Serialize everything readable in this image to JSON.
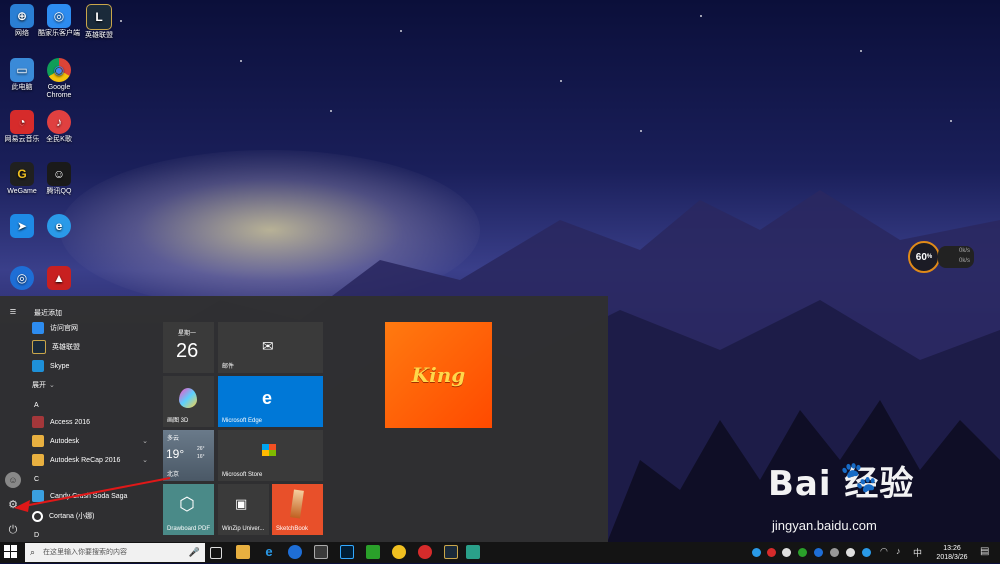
{
  "desktop": {
    "icons": [
      {
        "label": "网络",
        "color": "#2a7fd4",
        "glyph": "⊕"
      },
      {
        "label": "酷家乐客户端",
        "color": "#2d8cf0",
        "glyph": "◎"
      },
      {
        "label": "英雄联盟",
        "color": "#1a2a3a",
        "glyph": "L"
      },
      {
        "label": "此电脑",
        "color": "#3a8ad8",
        "glyph": "▭"
      },
      {
        "label": "Google Chrome",
        "color": "#e0e0e0",
        "glyph": "◉"
      },
      {
        "label": "网易云音乐",
        "color": "#d62b2b",
        "glyph": "◔"
      },
      {
        "label": "全民K歌",
        "color": "#e04040",
        "glyph": "♪"
      },
      {
        "label": "WeGame",
        "color": "#202020",
        "glyph": "G"
      },
      {
        "label": "腾讯QQ",
        "color": "#1a1a1a",
        "glyph": "☺"
      },
      {
        "label": "",
        "color": "#1e8ae6",
        "glyph": "➤"
      },
      {
        "label": "",
        "color": "#2a9ae8",
        "glyph": "e"
      },
      {
        "label": "",
        "color": "#1e6ed6",
        "glyph": "◎"
      },
      {
        "label": "",
        "color": "#c82020",
        "glyph": "▲"
      }
    ]
  },
  "speed_widget": {
    "value": "60",
    "unit": "%",
    "up": "0k/s",
    "down": "0k/s"
  },
  "start_menu": {
    "recent_header": "最近添加",
    "recent": [
      {
        "label": "访问官网",
        "color": "#2d8cf0"
      },
      {
        "label": "英雄联盟",
        "color": "#1a2a3a"
      },
      {
        "label": "Skype",
        "color": "#1e90d8"
      }
    ],
    "expand_label": "展开",
    "section_a": "A",
    "apps_a": [
      {
        "label": "Access 2016",
        "color": "#a4373a",
        "chevron": ""
      },
      {
        "label": "Autodesk",
        "color": "#e8b040",
        "chevron": "⌄"
      },
      {
        "label": "Autodesk ReCap 2016",
        "color": "#e8b040",
        "chevron": "⌄"
      }
    ],
    "section_c": "C",
    "apps_c": [
      {
        "label": "Candy Crush Soda Saga",
        "color": "#3aa0e0"
      },
      {
        "label": "Cortana (小娜)",
        "color": "#303030"
      }
    ],
    "section_d": "D",
    "tiles": {
      "calendar_day": "星期一",
      "calendar_date": "26",
      "mail": "邮件",
      "paint3d": "画图 3D",
      "edge": "Microsoft Edge",
      "weather_cond": "多云",
      "weather_temp": "19°",
      "weather_high": "26°",
      "weather_low": "16°",
      "weather_city": "北京",
      "store": "Microsoft Store",
      "drawboard": "Drawboard PDF",
      "winzip": "WinZip Univer...",
      "sketchbook": "SketchBook",
      "king": "King"
    }
  },
  "taskbar": {
    "search_placeholder": "在这里输入你要搜索的内容",
    "time": "13:26",
    "date": "2018/3/26"
  },
  "watermark": {
    "brand": "Bai  经验",
    "url": "jingyan.baidu.com"
  }
}
